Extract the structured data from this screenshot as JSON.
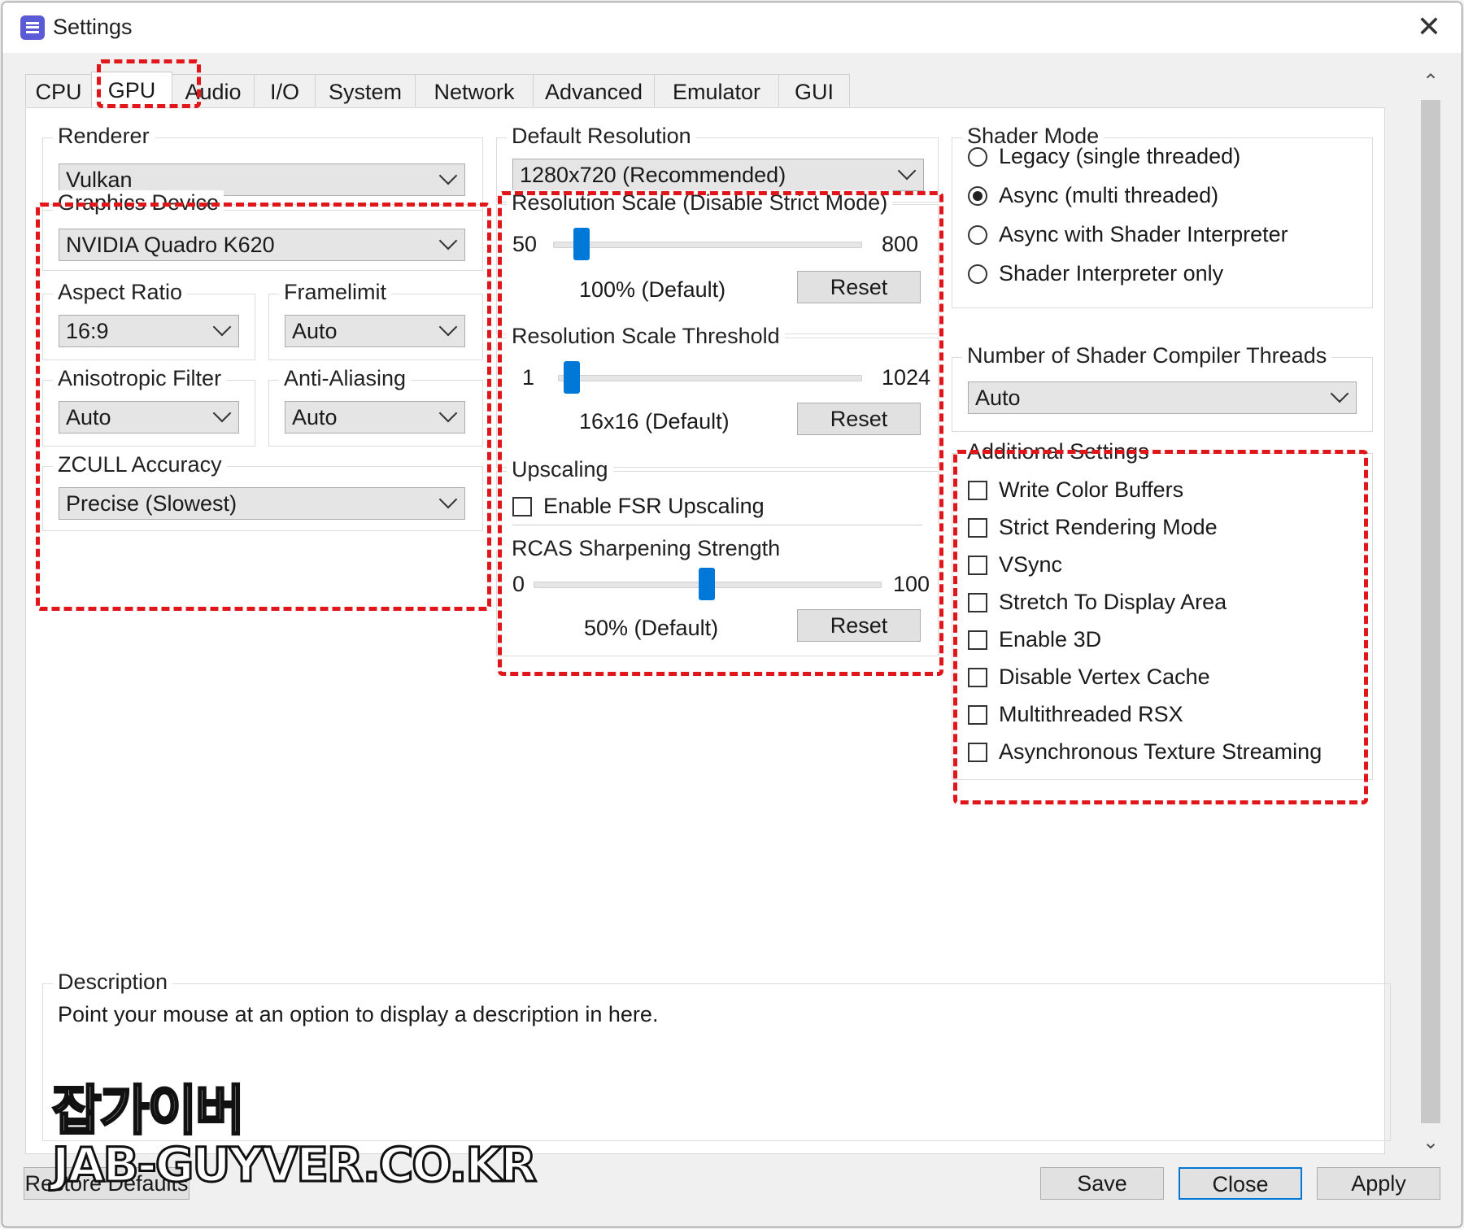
{
  "window": {
    "title": "Settings",
    "close_glyph": "✕"
  },
  "tabs": [
    {
      "label": "CPU"
    },
    {
      "label": "GPU"
    },
    {
      "label": "Audio"
    },
    {
      "label": "I/O"
    },
    {
      "label": "System"
    },
    {
      "label": "Network"
    },
    {
      "label": "Advanced"
    },
    {
      "label": "Emulator"
    },
    {
      "label": "GUI"
    }
  ],
  "active_tab": "GPU",
  "left": {
    "renderer": {
      "title": "Renderer",
      "value": "Vulkan"
    },
    "graphics_device": {
      "title": "Graphics Device",
      "value": "NVIDIA Quadro K620"
    },
    "aspect_ratio": {
      "title": "Aspect Ratio",
      "value": "16:9"
    },
    "framelimit": {
      "title": "Framelimit",
      "value": "Auto"
    },
    "anisotropic": {
      "title": "Anisotropic Filter",
      "value": "Auto"
    },
    "anti_aliasing": {
      "title": "Anti-Aliasing",
      "value": "Auto"
    },
    "zcull": {
      "title": "ZCULL Accuracy",
      "value": "Precise (Slowest)"
    }
  },
  "middle": {
    "default_resolution": {
      "title": "Default Resolution",
      "value": "1280x720 (Recommended)"
    },
    "resolution_scale": {
      "title": "Resolution Scale (Disable Strict Mode)",
      "min": "50",
      "max": "800",
      "value_label": "100% (Default)",
      "reset": "Reset",
      "position": 0.07
    },
    "threshold": {
      "title": "Resolution Scale Threshold",
      "min": "1",
      "max": "1024",
      "value_label": "16x16 (Default)",
      "reset": "Reset",
      "position": 0.02
    },
    "upscaling": {
      "title": "Upscaling",
      "fsr_label": "Enable FSR Upscaling"
    },
    "rcas": {
      "title": "RCAS Sharpening Strength",
      "min": "0",
      "max": "100",
      "value_label": "50% (Default)",
      "reset": "Reset",
      "position": 0.5
    }
  },
  "right": {
    "shader_mode": {
      "title": "Shader Mode",
      "options": [
        "Legacy (single threaded)",
        "Async (multi threaded)",
        "Async with Shader Interpreter",
        "Shader Interpreter only"
      ],
      "selected_index": 1
    },
    "compiler_threads": {
      "title": "Number of Shader Compiler Threads",
      "value": "Auto"
    },
    "additional": {
      "title": "Additional Settings",
      "items": [
        "Write Color Buffers",
        "Strict Rendering Mode",
        "VSync",
        "Stretch To Display Area",
        "Enable 3D",
        "Disable Vertex Cache",
        "Multithreaded RSX",
        "Asynchronous Texture Streaming"
      ]
    }
  },
  "description": {
    "title": "Description",
    "text": "Point your mouse at an option to display a description in here."
  },
  "footer": {
    "restore": "Restore Defaults",
    "save": "Save",
    "close": "Close",
    "apply": "Apply"
  },
  "scroll": {
    "up_glyph": "⌃",
    "down_glyph": "⌄"
  },
  "watermark": {
    "korean": "잡가이버",
    "site": "JAB-GUYVER.CO.KR"
  },
  "colors": {
    "accent": "#0078d7",
    "highlight": "#e0161b"
  }
}
